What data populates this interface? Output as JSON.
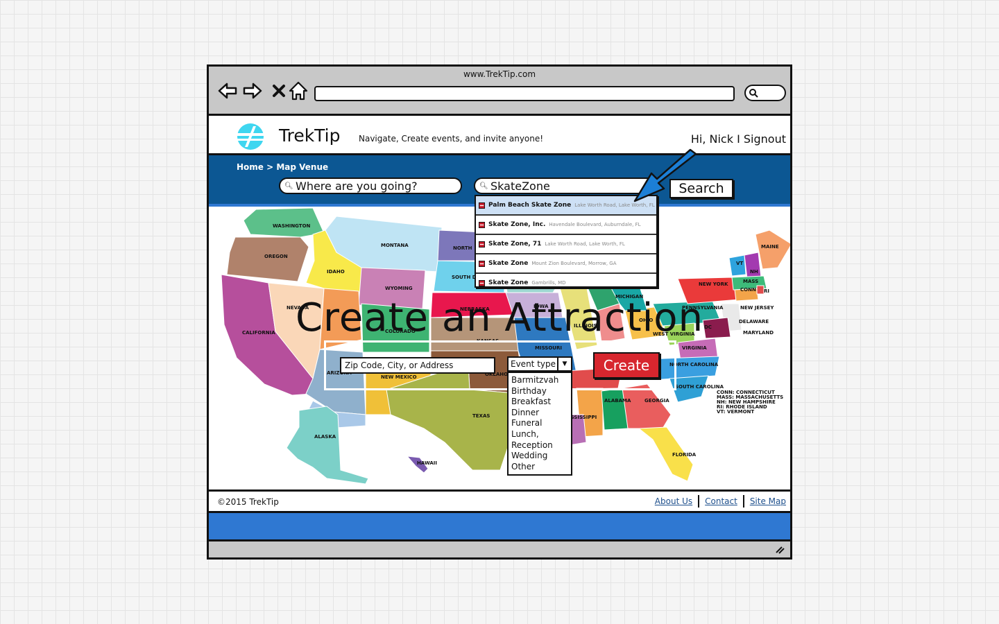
{
  "browser": {
    "url": "www.TrekTip.com"
  },
  "header": {
    "brand": "TrekTip",
    "tagline": "Navigate, Create events, and invite anyone!",
    "greeting": "Hi, Nick",
    "separator": "I",
    "signout": "Signout"
  },
  "breadcrumb": "Home > Map Venue",
  "search": {
    "location_placeholder": "Where are you going?",
    "query": "SkateZone",
    "button": "Search"
  },
  "suggestions": [
    {
      "name": "Palm Beach Skate Zone",
      "address": "Lake Worth Road, Lake Worth, FL"
    },
    {
      "name": "Skate Zone, Inc.",
      "address": "Havendale Boulevard, Auburndale, FL"
    },
    {
      "name": "Skate Zone, 71",
      "address": "Lake Worth Road, Lake Worth, FL"
    },
    {
      "name": "Skate Zone",
      "address": "Mount Zion Boulevard, Morrow, GA"
    },
    {
      "name": "Skate Zone",
      "address": "Gambrills, MD"
    }
  ],
  "attraction": {
    "title": "Create an Attraction",
    "zip_placeholder": "Zip Code, City, or Address",
    "event_type_label": "Event type",
    "event_types": [
      "Barmitzvah",
      "Birthday",
      "Breakfast",
      "Dinner",
      "Funeral",
      "Lunch,",
      "Reception",
      "Wedding",
      "Other"
    ],
    "create_button": "Create"
  },
  "map": {
    "states": {
      "washington": "WASHINGTON",
      "oregon": "OREGON",
      "california": "CALIFORNIA",
      "nevada": "NEVADA",
      "idaho": "IDAHO",
      "montana": "MONTANA",
      "wyoming": "WYOMING",
      "north_dakota": "NORTH",
      "south_dakota": "SOUTH D",
      "nebraska": "NEBRASKA",
      "colorado": "COLORADO",
      "arizona": "ARIZONA",
      "new_mexico": "NEW MEXICO",
      "kansas": "KANSAS",
      "oklahoma": "OKLAHO",
      "texas": "TEXAS",
      "iowa": "IOWA",
      "missouri": "MISSOURI",
      "michigan": "MICHIGAN",
      "ohio": "OHIO",
      "pennsylvania": "PENNSYLVANIA",
      "new_york": "NEW YORK",
      "maine": "MAINE",
      "vt": "VT",
      "nh": "NH",
      "mass": "MASS",
      "conn": "CONN",
      "ri": "RI",
      "new_jersey": "NEW JERSEY",
      "delaware": "DELAWARE",
      "maryland": "MARYLAND",
      "dc": "DC",
      "virginia": "VIRGINIA",
      "west_virginia": "WEST VIRGINIA",
      "north_carolina": "NORTH CAROLINA",
      "south_carolina": "SOUTH CAROLINA",
      "georgia": "GEORGIA",
      "alabama": "ALABAMA",
      "mississippi": "MISSISSIPPI",
      "florida": "FLORIDA",
      "alaska": "ALASKA",
      "hawaii": "HAWAII",
      "illinois": "ILLINOIS"
    },
    "legend": [
      "CONN: CONNECTICUT",
      "MASS: MASSACHUSETTS",
      "NH: NEW HAMPSHIRE",
      "RI: RHODE ISLAND",
      "VT: VERMONT"
    ]
  },
  "footer": {
    "copyright": "©2015 TrekTip",
    "links": [
      "About Us",
      "Contact",
      "Site Map"
    ]
  },
  "icons": {
    "back": "arrow-left-icon",
    "forward": "arrow-right-icon",
    "stop": "close-icon",
    "home": "home-icon",
    "search": "search-icon",
    "logo": "trektip-logo",
    "pin": "map-pin-icon"
  },
  "colors": {
    "nav_blue": "#0c5793",
    "footer_blue": "#2f78d2",
    "create_red": "#d7262e",
    "highlight": "#cde0f5"
  }
}
